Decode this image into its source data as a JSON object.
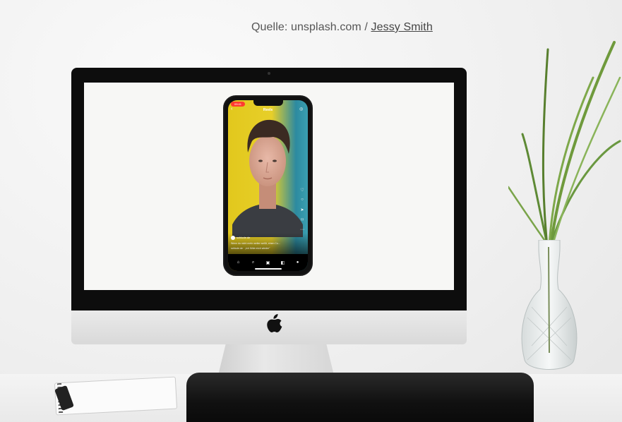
{
  "caption": {
    "prefix": "Quelle: unsplash.com / ",
    "author": "Jessy Smith"
  },
  "phone": {
    "header_title": "Reels",
    "status_time": "09:41",
    "account_name": "schlude.de",
    "caption_text": "Wenn du nicht mehr weiter weißt, einen Co...",
    "audio_text": "schlude.de · „Ich fühle mich wieder\""
  },
  "colors": {
    "screen_bg": "#f7f7f5",
    "bezel": "#0d0d0d",
    "backdrop_yellow": "#e2c81d",
    "backdrop_teal": "#2d8aa0"
  },
  "icons": {
    "back": "back-arrow-icon",
    "camera": "camera-icon",
    "like": "heart-icon",
    "comment": "comment-icon",
    "share": "send-icon",
    "save": "bookmark-icon",
    "more": "more-icon",
    "nav": [
      "home-icon",
      "search-icon",
      "reels-icon",
      "shop-icon",
      "profile-icon"
    ],
    "brand": "apple-logo-icon"
  }
}
